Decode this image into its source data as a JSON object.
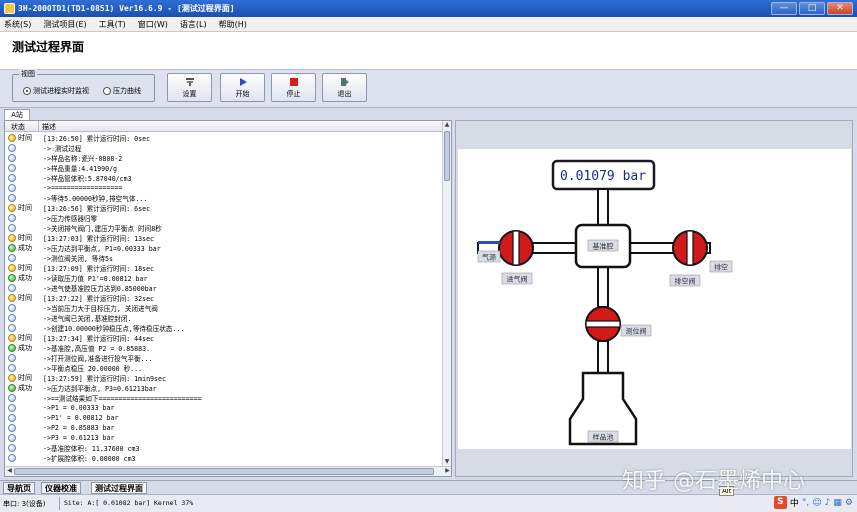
{
  "window": {
    "title": "3H-2000TD1(TD1-0851) Ver16.6.9 - [测试过程界面]",
    "min": "—",
    "max": "□",
    "close": "✕"
  },
  "menu": [
    "系统(S)",
    "测试项目(E)",
    "工具(T)",
    "窗口(W)",
    "语言(L)",
    "帮助(H)"
  ],
  "header": {
    "title": "测试过程界面"
  },
  "view": {
    "legend": "视图",
    "option1": "测试进程实时监视",
    "option2": "压力曲线",
    "selected": "测试进程实时监视"
  },
  "toolbar": {
    "settings": "设置",
    "start": "开始",
    "stop": "停止",
    "exit": "退出"
  },
  "station_tab": "A站",
  "log": {
    "col_status": "状态",
    "col_desc": "描述",
    "rows": [
      {
        "type": "time",
        "status": "时间",
        "text": "[13:26:50]   累计运行时间: 0sec"
      },
      {
        "type": "info",
        "status": "",
        "text": "->☆测试过程"
      },
      {
        "type": "info",
        "status": "",
        "text": "->样品名称:瓷兴-0808-2"
      },
      {
        "type": "info",
        "status": "",
        "text": "->样品重量:4.41990/g"
      },
      {
        "type": "info",
        "status": "",
        "text": "->样品管体积:5.87040/cm3"
      },
      {
        "type": "info",
        "status": "",
        "text": "->=================="
      },
      {
        "type": "info",
        "status": "",
        "text": "->等待5.00000秒钟,排空气体..."
      },
      {
        "type": "time",
        "status": "时间",
        "text": "[13:26:56]   累计运行时间: 6sec"
      },
      {
        "type": "info",
        "status": "",
        "text": "->压力传感器归零"
      },
      {
        "type": "info",
        "status": "",
        "text": "->关闭排气阀门,建压力平衡点 时间8秒"
      },
      {
        "type": "time",
        "status": "时间",
        "text": "[13:27:03]   累计运行时间: 13sec"
      },
      {
        "type": "ok",
        "status": "成功",
        "text": "->压力达到平衡点, P1=0.00333 bar"
      },
      {
        "type": "info",
        "status": "",
        "text": "->测位阀关闭, 等待5s"
      },
      {
        "type": "time",
        "status": "时间",
        "text": "[13:27:09]   累计运行时间: 18sec"
      },
      {
        "type": "ok",
        "status": "成功",
        "text": "->读取压力值 P1'=0.00812 bar"
      },
      {
        "type": "info",
        "status": "",
        "text": "->进气使基准腔压力达到0.85000bar"
      },
      {
        "type": "time",
        "status": "时间",
        "text": "[13:27:22]   累计运行时间: 32sec"
      },
      {
        "type": "info",
        "status": "",
        "text": "->当前压力大于目标压力, 关闭进气阀"
      },
      {
        "type": "info",
        "status": "",
        "text": "->进气阀已关闭,基准腔封闭."
      },
      {
        "type": "info",
        "status": "",
        "text": "->创建10.00000秒钟稳压点,等待稳压状态..."
      },
      {
        "type": "time",
        "status": "时间",
        "text": "[13:27:34]   累计运行时间: 44sec"
      },
      {
        "type": "ok",
        "status": "成功",
        "text": "->基准腔,高压值 P2 = 0.85883."
      },
      {
        "type": "info",
        "status": "",
        "text": "->打开测位阀,准备进行投气平衡..."
      },
      {
        "type": "info",
        "status": "",
        "text": "->平衡点稳压 20.00000 秒..."
      },
      {
        "type": "time",
        "status": "时间",
        "text": "[13:27:59]   累计运行时间: 1min9sec"
      },
      {
        "type": "ok",
        "status": "成功",
        "text": "->压力达到平衡点, P3=0.61213bar"
      },
      {
        "type": "info",
        "status": "",
        "text": "->==测试结果如下=========================="
      },
      {
        "type": "info",
        "status": "",
        "text": "->P1 = 0.00333 bar"
      },
      {
        "type": "info",
        "status": "",
        "text": "->P1' = 0.00812 bar"
      },
      {
        "type": "info",
        "status": "",
        "text": "->P2 = 0.85883 bar"
      },
      {
        "type": "info",
        "status": "",
        "text": "->P3 = 0.61213 bar"
      },
      {
        "type": "info",
        "status": "",
        "text": "->基准腔体积: 11.37600 cm3"
      },
      {
        "type": "info",
        "status": "",
        "text": "->扩展腔体积: 0.00000 cm3"
      }
    ]
  },
  "diagram": {
    "pressure_display": "0.01079 bar",
    "labels": {
      "gas_source": "气源",
      "inlet_valve": "进气阀",
      "reference_chamber": "基准腔",
      "vent": "排空",
      "vent_valve": "排空阀",
      "test_valve": "测位阀",
      "sample_tube": "样品池"
    },
    "colors": {
      "valve": "#d11b1b",
      "pipe": "#111111",
      "display_text": "#1a2d8a"
    }
  },
  "bottom_nav": [
    "导航页",
    "仪器校准",
    "测试过程界面"
  ],
  "bottom_nav_active": "测试过程界面",
  "status": {
    "port": "串口: 3(设备)",
    "site": "Site: A:[ 0.01082 bar] Kernel 37%"
  },
  "watermark": "知乎 @石墨烯中心",
  "ime_tip": "Alt"
}
